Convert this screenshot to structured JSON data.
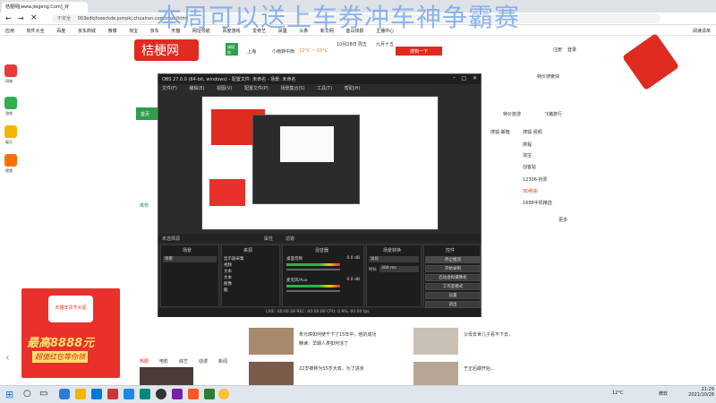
{
  "browser": {
    "tab_title": "桔梗网[www.jiegeng.Com]_好",
    "url_prefix": "不安全",
    "url": "003edkjfceeckde.jumpkj.chuairan.com/zhzn/html",
    "bookmarks": [
      "应用",
      "软件大全",
      "百度",
      "京东商城",
      "微博",
      "淘宝",
      "京东",
      "天猫",
      "网址导航",
      "百度游戏",
      "爱奇艺",
      "凤凰",
      "头条",
      "新华网",
      "金山快报",
      "主播中心"
    ],
    "reading_list": "阅读清单"
  },
  "overlay_text": "本周可以送上车券冲车神争霸赛",
  "site": {
    "logo": "桔梗网",
    "weather_tag": "请搜狗",
    "city": "上海",
    "weather": "小雨转中雨",
    "temp": "12°C ~ 15°C",
    "date": "10月28日",
    "weekday": "周五",
    "lunar": "九月十五",
    "search_btn": "搜狗一下",
    "header_links": [
      "注册",
      "登录"
    ],
    "header_link2": "特价搜索快",
    "nav": [
      "首页",
      "电影",
      "小说",
      "游戏",
      "特价旅游",
      "飞猪旅行"
    ],
    "left_icons": [
      "同城",
      "游戏",
      "娱乐",
      "视频"
    ],
    "right_list": [
      "搜狐·邮箱",
      "搜狐·视频",
      "12306·抢票",
      "3D购车",
      "1688手机精选"
    ],
    "right_list2": [
      "携程",
      "淘宝",
      "创客贴"
    ],
    "news_title": "推荐",
    "more": "更多",
    "lower_headlines": [
      "朱元璋如何使千下了15年中，他的成功",
      "精读：早期人类如何活了",
      "22岁被称为55岁大叔，为了进京",
      "于正后期开始...",
      "父母去世儿子看不下去，",
      "小学生被骗了",
      "小学生的那天，他的成功",
      "人民日报官方"
    ],
    "bottom_tabs": [
      "热剧",
      "电影",
      "综艺",
      "动漫",
      "新闻"
    ]
  },
  "obs": {
    "title": "OBS 27.0.0 (64-bit, windows) - 配置文件: 未命名 - 场景: 未命名",
    "menu": [
      "文件(F)",
      "编辑(E)",
      "视图(V)",
      "配置文件(P)",
      "场景集合(S)",
      "工具(T)",
      "帮助(H)"
    ],
    "no_source": "未选择源",
    "properties_btn": "属性",
    "filters_btn": "滤镜",
    "docks": {
      "scenes": "场景",
      "sources": "来源",
      "mixer": "混音器",
      "transitions": "场景转换",
      "controls": "控件"
    },
    "scene_list": [
      "场景"
    ],
    "source_list": [
      "显示器采集",
      "视频",
      "文本",
      "文本",
      "图像",
      "截"
    ],
    "mixer_tracks": [
      "桌面音频",
      "麦克风/Aux"
    ],
    "mixer_db": [
      "0.0 dB",
      "0.0 dB"
    ],
    "transition": "淡化",
    "duration_label": "时长",
    "duration": "300 ms",
    "controls": [
      "停止推流",
      "开始录制",
      "启动虚拟摄像机",
      "工作室模式",
      "设置",
      "退出"
    ],
    "status": "LIVE: 00:00:28  REC: 00:00:00  CPU: 0.9%, 60.00 fps"
  },
  "ad": {
    "top": "天猫年货节大促",
    "big": "最高8888元",
    "sub": "超值红包等你领"
  },
  "taskbar": {
    "weather": "12°C",
    "ime": "微软",
    "time": "21:29",
    "date": "2021/10/28"
  }
}
